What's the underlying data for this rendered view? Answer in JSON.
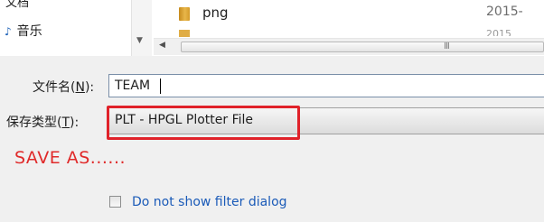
{
  "nav_pane": {
    "cut_item_label": "文档",
    "music_item_label": "音乐",
    "music_icon": "music-note-icon"
  },
  "file_list": {
    "rows": [
      {
        "name": "png",
        "date": "2015-",
        "icon": "folder-icon"
      },
      {
        "name": "",
        "date": "2015",
        "icon": "folder-icon"
      }
    ],
    "hscroll_grip": "III"
  },
  "form": {
    "filename_label_prefix": "文件名(",
    "filename_label_key": "N",
    "filename_label_suffix": "):",
    "filename_value": "TEAM",
    "filetype_label_prefix": "保存类型(",
    "filetype_label_key": "T",
    "filetype_label_suffix": "):",
    "filetype_value": "PLT - HPGL Plotter File"
  },
  "annotation": {
    "save_as_text": "SAVE AS......",
    "highlight_color": "#e0222a"
  },
  "options": {
    "hide_filter_label": "Do not show filter dialog",
    "hide_filter_checked": false
  }
}
